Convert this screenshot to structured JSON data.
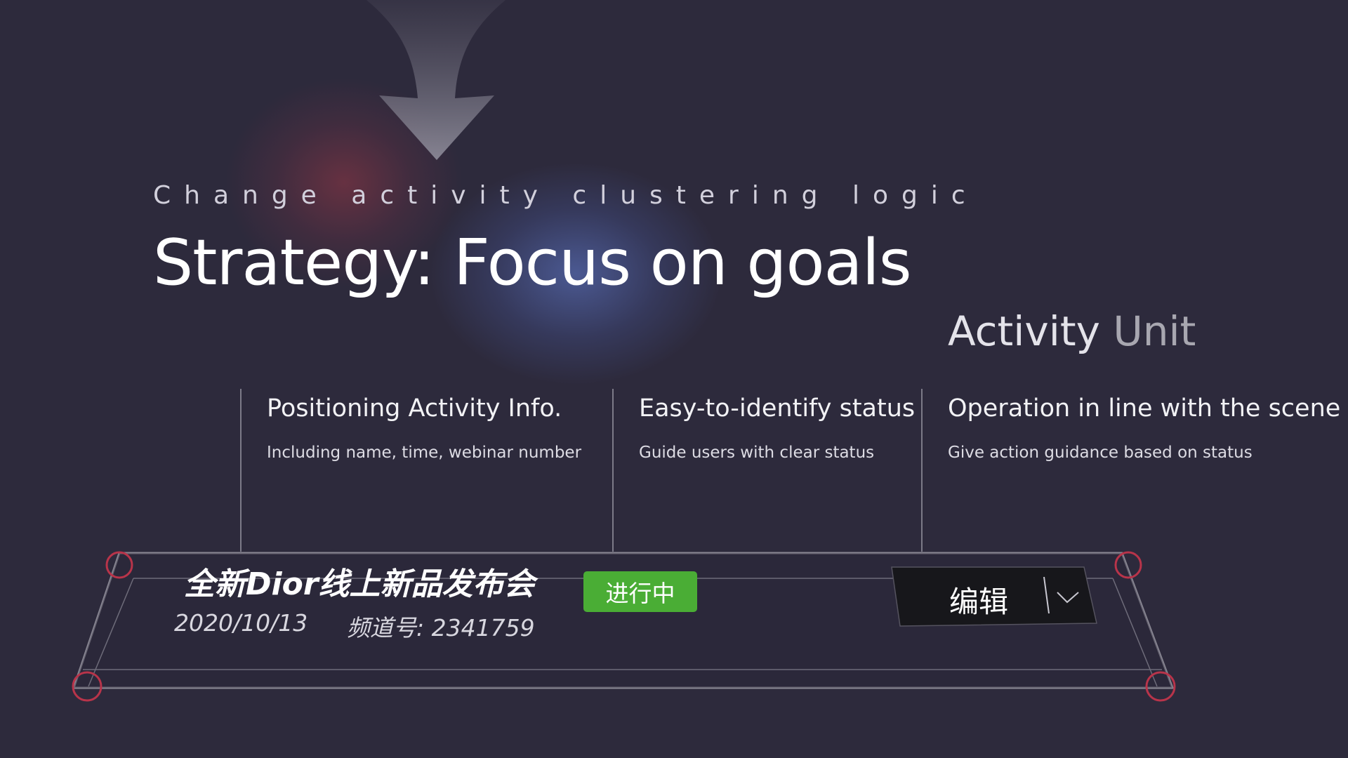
{
  "header": {
    "subtitle": "Change activity clustering logic",
    "title": "Strategy: Focus on goals"
  },
  "unit_title": {
    "part1": "Activity",
    "part2": "Unit"
  },
  "columns": [
    {
      "heading": "Positioning Activity Info.",
      "description": "Including name, time, webinar number"
    },
    {
      "heading": "Easy-to-identify status",
      "description": "Guide users with clear status"
    },
    {
      "heading": "Operation in line with the scene",
      "description": "Give action guidance based on status"
    }
  ],
  "activity": {
    "name": "全新Dior线上新品发布会",
    "date": "2020/10/13",
    "channel": "频道号: 2341759",
    "status": "进行中",
    "edit_label": "编辑"
  },
  "icons": {
    "arrow": "down-arrow-icon",
    "chevron": "chevron-down-icon"
  },
  "colors": {
    "background": "#2d2a3c",
    "status_green": "#4aad35",
    "corner_marker": "#b8344a",
    "button_dark": "#17171b"
  }
}
